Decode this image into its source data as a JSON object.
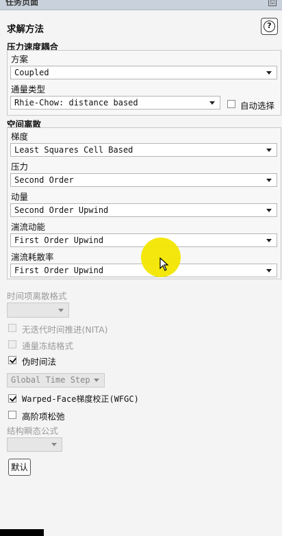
{
  "window": {
    "title": "任务页面"
  },
  "panel": {
    "title": "求解方法",
    "help_symbol": "?"
  },
  "pressure_velocity": {
    "header": "压力速度耦合",
    "scheme_label": "方案",
    "scheme_value": "Coupled",
    "flux_label": "通量类型",
    "flux_value": "Rhie-Chow: distance based",
    "auto_select_label": "自动选择",
    "auto_select_checked": false
  },
  "spatial": {
    "header": "空间离散",
    "rows": [
      {
        "label": "梯度",
        "value": "Least Squares Cell Based"
      },
      {
        "label": "压力",
        "value": "Second Order"
      },
      {
        "label": "动量",
        "value": "Second Order Upwind"
      },
      {
        "label": "湍流动能",
        "value": "First Order Upwind"
      },
      {
        "label": "湍流耗散率",
        "value": "First Order Upwind"
      }
    ]
  },
  "transient": {
    "label": "时间项离散格式",
    "value": ""
  },
  "options": {
    "nita_label": "无迭代时间推进(NITA)",
    "nita_checked": false,
    "frozen_flux_label": "通量冻结格式",
    "frozen_flux_checked": false,
    "pseudo_time_label": "伪时间法",
    "pseudo_time_checked": true,
    "pseudo_time_select": "Global Time Step",
    "wfgc_label": "Warped-Face梯度校正(WFGC)",
    "wfgc_checked": true,
    "relax_label": "高阶项松弛",
    "relax_checked": false
  },
  "structure": {
    "label": "结构瞬态公式",
    "value": ""
  },
  "buttons": {
    "default_label": "默认"
  }
}
